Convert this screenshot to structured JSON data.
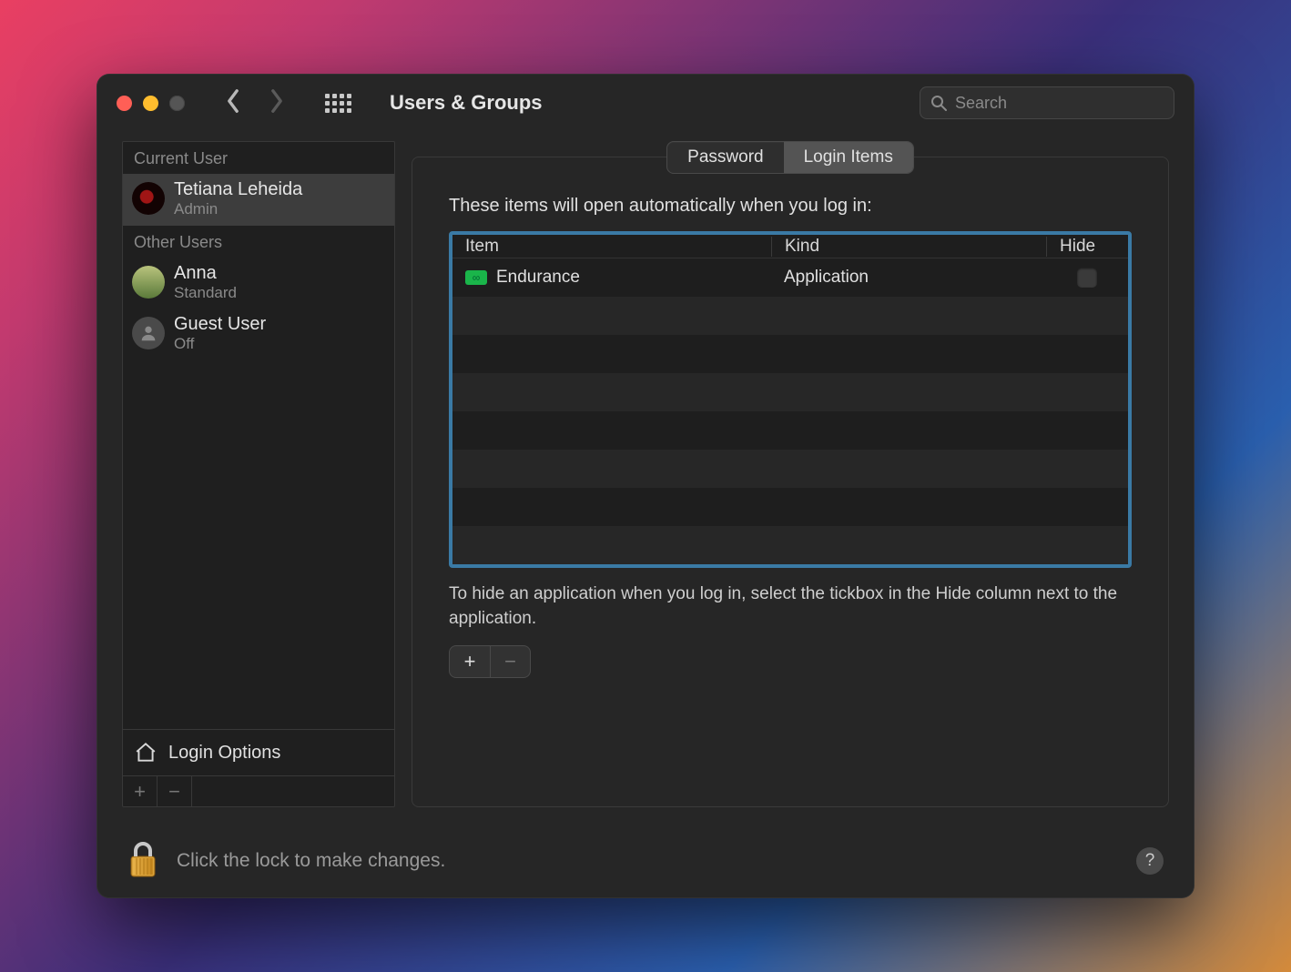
{
  "window": {
    "title": "Users & Groups",
    "search_placeholder": "Search"
  },
  "sidebar": {
    "current_label": "Current User",
    "other_label": "Other Users",
    "current_user": {
      "name": "Tetiana Leheida",
      "role": "Admin"
    },
    "other_users": [
      {
        "name": "Anna",
        "role": "Standard"
      },
      {
        "name": "Guest User",
        "role": "Off"
      }
    ],
    "login_options_label": "Login Options"
  },
  "tabs": {
    "password": "Password",
    "login_items": "Login Items",
    "active": "login_items"
  },
  "login_items_panel": {
    "intro": "These items will open automatically when you log in:",
    "columns": {
      "item": "Item",
      "kind": "Kind",
      "hide": "Hide"
    },
    "rows": [
      {
        "name": "Endurance",
        "kind": "Application",
        "hide": false
      }
    ],
    "hint": "To hide an application when you log in, select the tickbox in the Hide column next to the application."
  },
  "footer": {
    "lock_text": "Click the lock to make changes."
  }
}
